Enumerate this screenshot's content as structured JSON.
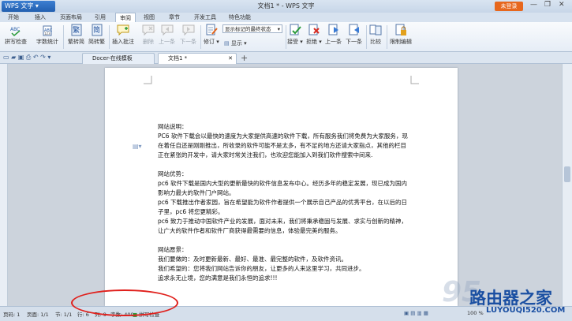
{
  "app": {
    "button_label": "WPS 文字",
    "title": "文档1 * - WPS 文字",
    "login_label": "未登录",
    "window_controls": [
      "—",
      "❐",
      "✕"
    ]
  },
  "menu": {
    "items": [
      "开始",
      "插入",
      "页面布局",
      "引用",
      "审阅",
      "视图",
      "章节",
      "开发工具",
      "特色功能"
    ],
    "active_index": 4
  },
  "ribbon": {
    "spell_check": "拼写检查",
    "word_count": "字数统计",
    "trad_to_simp": "繁转简",
    "simp_to_trad": "简转繁",
    "insert_comment": "插入批注",
    "delete": "删除",
    "prev": "上一条",
    "next": "下一条",
    "revise": "修订",
    "display_state": "显示标记的最终状态",
    "show": "显示",
    "accept": "接受",
    "reject": "拒绝",
    "prev_change": "上一条",
    "next_change": "下一条",
    "compare": "比较",
    "restrict_edit": "限制编辑"
  },
  "tabs": {
    "tab1": "Docer-在线模板",
    "tab2": "文档1 *",
    "add": "+"
  },
  "document": {
    "lines": [
      "网站说明：",
      "PC6 软件下载会以最快的速度为大家提供高速的软件下载，所有服务我们将免费为大家服务，现",
      "在着任自还是刚刚推出，所收录的软件可能不是太多，有不足的地方还请大家指点，其他的栏目",
      "正在紧张的开发中，请大家时常关注我们，也欢迎您能加入到我们软件搜索中间来.",
      "",
      "网站优势：",
      "pc6 软件下载是国内大型的更新最快的软件信息发布中心。经历多年的稳定发展，现已成为国内",
      "影响力最大的软件门户网站。",
      "pc6 下载推出作者家园，旨在希望能为软件作者提供一个展示自己产品的优秀平台，在以后的日",
      "子里，pc6 将您更精彩。",
      "pc6 致力于推动中国软件产业的发展，面对未来，我们将秉承稳固与发展、求实与创新的精神，",
      "让广大的软件作者和软件厂商获得最需要的信息，体验最完美的服务。",
      "",
      "网站愿景：",
      "我们要做的：及时更新最新、最好、最准、最完整的软件，及软件资讯。",
      "我们希望的：您将我们网站告诉你的朋友，让更多的人来这里学习，共同进步。",
      "追求永无止境，您的满意是我们永恒的追求!!!"
    ]
  },
  "status": {
    "page": "页码: 1",
    "pages": "页面: 1/1",
    "section": "节: 1/1",
    "row": "行: 6",
    "col": "列: 9",
    "words": "字数: 400",
    "spell": "拼写检查",
    "zoom": "100 %"
  },
  "watermark": {
    "text": "路由器之家",
    "url": "LUYOUQI520.COM",
    "number": "95"
  },
  "colors": {
    "accent": "#225fb0",
    "login": "#e7671d",
    "annotation": "#e0201c"
  }
}
